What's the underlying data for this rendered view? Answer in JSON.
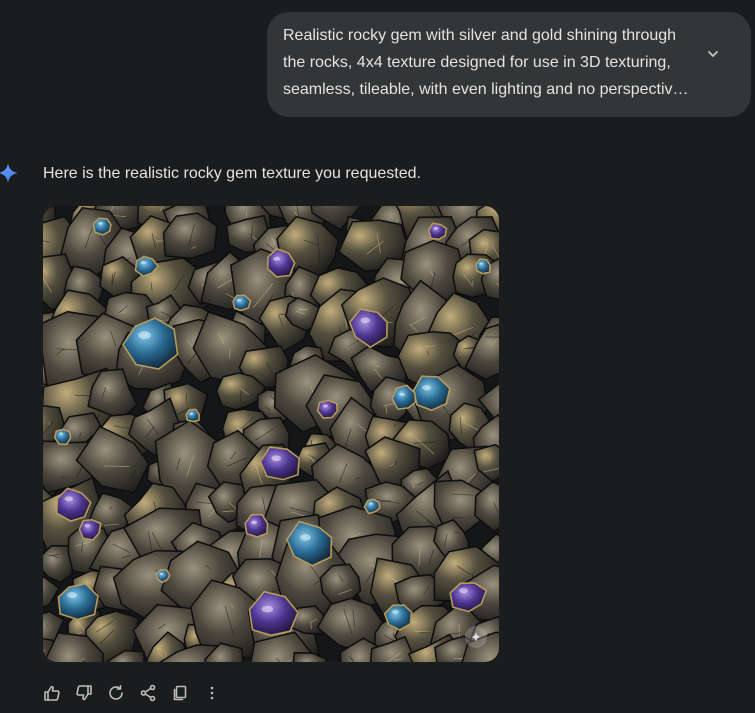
{
  "user_prompt": {
    "text": "Realistic rocky gem with silver and gold shining through the rocks, 4x4 texture designed for use in 3D texturing, seamless, tileable, with even lighting and no perspectiv…",
    "expand_icon": "chevron-down-icon"
  },
  "response": {
    "text": "Here is the realistic rocky gem texture you requested.",
    "icon": "gemini-spark-icon",
    "image": {
      "badge_icon": "ai-generated-badge-icon",
      "palette": {
        "rock_dark": "#2a2a28",
        "rock_mid": "#4a463c",
        "rock_light": "#8c8470",
        "gold": "#b89a5c",
        "gem_blue": "#2f6f95",
        "gem_purple": "#5b3f9a"
      }
    }
  },
  "actions": [
    {
      "name": "thumbs-up",
      "icon": "thumbs-up-icon"
    },
    {
      "name": "thumbs-down",
      "icon": "thumbs-down-icon"
    },
    {
      "name": "regenerate",
      "icon": "refresh-icon"
    },
    {
      "name": "share",
      "icon": "share-icon"
    },
    {
      "name": "copy",
      "icon": "copy-icon"
    },
    {
      "name": "more",
      "icon": "more-vert-icon"
    }
  ],
  "colors": {
    "background": "#1b1c1d",
    "bubble": "#333537",
    "text": "#e3e3e3",
    "spark": "#4c8df6"
  }
}
